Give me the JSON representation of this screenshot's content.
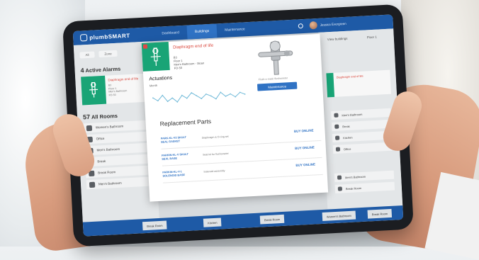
{
  "app": {
    "brand": "plumbSMART",
    "user_name": "Jessica Evergreen"
  },
  "nav": {
    "tabs": [
      {
        "label": "Dashboard"
      },
      {
        "label": "Buildings"
      },
      {
        "label": "Maintenance"
      }
    ]
  },
  "left": {
    "filters": [
      "All",
      "Zone"
    ],
    "alarms_count": "4",
    "alarms_label": "Active Alarms",
    "alarm_card": {
      "title": "Diaphragm end of life",
      "meta": [
        "B3",
        "Floor 1",
        "Men's Bathroom",
        "FO-50"
      ]
    },
    "rooms_count": "57",
    "rooms_label": "All Rooms",
    "rooms": [
      "Women's Bathroom",
      "Office",
      "Men's Bathroom",
      "Break",
      "Break Room",
      "Men's Bathroom"
    ]
  },
  "right": {
    "buttons": [
      "View buildings",
      "Floor 1"
    ],
    "alert_title": "Diaphragm end of life",
    "rows": [
      "Men's Bathroom",
      "Break",
      "Kitchen",
      "Office",
      "Men's Bathroom",
      "Break Room"
    ]
  },
  "modal": {
    "title": "Diaphragm end of life",
    "meta": [
      "B3",
      "Floor 1",
      "Men's Bathroom - Sloan",
      "FO-50"
    ],
    "product_caption": "Flush-o-matic flushometer",
    "maintenance_label": "Maintenance",
    "actuations_title": "Actuations",
    "actuations_sub": "Month",
    "replacement_title": "Replacement Parts",
    "parts": [
      {
        "name": "PARK-KL-V2 SKULT SEAL GASKET",
        "desc": "Diaphragm & O-ring set",
        "buy": "BUY ONLINE"
      },
      {
        "name": "PARKIN-KL-V SKULT SEAL BASE",
        "desc": "Seal kit for flushometer",
        "buy": "BUY ONLINE"
      },
      {
        "name": "PARKIN-KL-V-1 SOLENOID BASE",
        "desc": "Solenoid assembly",
        "buy": "BUY ONLINE"
      }
    ]
  },
  "bottom": {
    "chips": [
      "Break Room",
      "Kitchen",
      "Break Room",
      "Women's Bathroom",
      "Break Room"
    ]
  },
  "chart_data": {
    "type": "line",
    "x": [
      1,
      2,
      3,
      4,
      5,
      6,
      7,
      8,
      9,
      10,
      11,
      12,
      13,
      14,
      15,
      16,
      17,
      18,
      19,
      20
    ],
    "series": [
      {
        "values": [
          12,
          9,
          14,
          8,
          11,
          7,
          13,
          10,
          15,
          12,
          9,
          13,
          11,
          8,
          14,
          10,
          12,
          9,
          13,
          11
        ]
      }
    ],
    "ylim": [
      0,
      20
    ]
  },
  "colors": {
    "brand_blue": "#1e5aa6",
    "alarm_green": "#19a476",
    "alarm_red": "#d9453a"
  }
}
